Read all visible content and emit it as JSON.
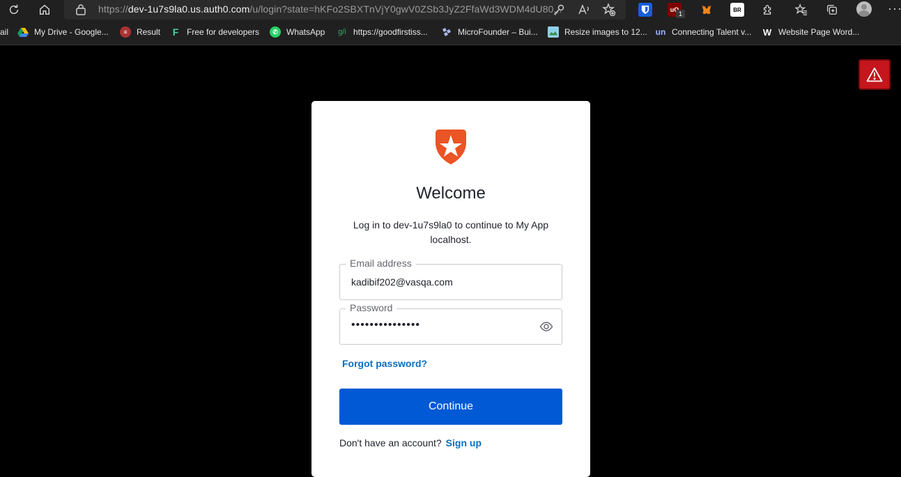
{
  "browser": {
    "url_scheme": "https://",
    "url_host": "dev-1u7s9la0.us.auth0.com",
    "url_path": "/u/login?state=hKFo2SBXTnVjY0gwV0ZSb3JyZ2FfaWd3WDM4dU80...",
    "extension_badge_count": "1",
    "icons": [
      "refresh-icon",
      "home-icon",
      "lock-icon",
      "key-icon",
      "read-aloud-icon",
      "add-favorite-icon",
      "bitwarden-icon",
      "ublock-icon",
      "metamask-icon",
      "br-icon",
      "extensions-icon",
      "favorites-icon",
      "collections-icon",
      "profile-avatar",
      "more-icon"
    ]
  },
  "bookmarks": [
    {
      "label": "ail",
      "icon": "gmail-icon"
    },
    {
      "label": "My Drive - Google...",
      "icon": "google-drive-icon"
    },
    {
      "label": "Result",
      "icon": "result-icon"
    },
    {
      "label": "Free for developers",
      "icon": "f-icon"
    },
    {
      "label": "WhatsApp",
      "icon": "whatsapp-icon"
    },
    {
      "label": "https://goodfirstiss...",
      "icon": "gfi-icon"
    },
    {
      "label": "MicroFounder – Bui...",
      "icon": "microfounder-icon"
    },
    {
      "label": "Resize images to 12...",
      "icon": "image-icon"
    },
    {
      "label": "Connecting Talent v...",
      "icon": "un-icon"
    },
    {
      "label": "Website Page Word...",
      "icon": "w-icon"
    }
  ],
  "login": {
    "title": "Welcome",
    "subtitle": "Log in to dev-1u7s9la0 to continue to My App localhost.",
    "email_label": "Email address",
    "email_value": "kadibif202@vasqa.com",
    "password_label": "Password",
    "password_value": "•••••••••••••••",
    "forgot_label": "Forgot password?",
    "continue_label": "Continue",
    "no_account_text": "Don't have an account?",
    "signup_label": "Sign up"
  },
  "colors": {
    "primary_button": "#0159d6",
    "link": "#0a6ebd",
    "auth0_logo": "#eb5424",
    "warning": "#c4161c"
  }
}
